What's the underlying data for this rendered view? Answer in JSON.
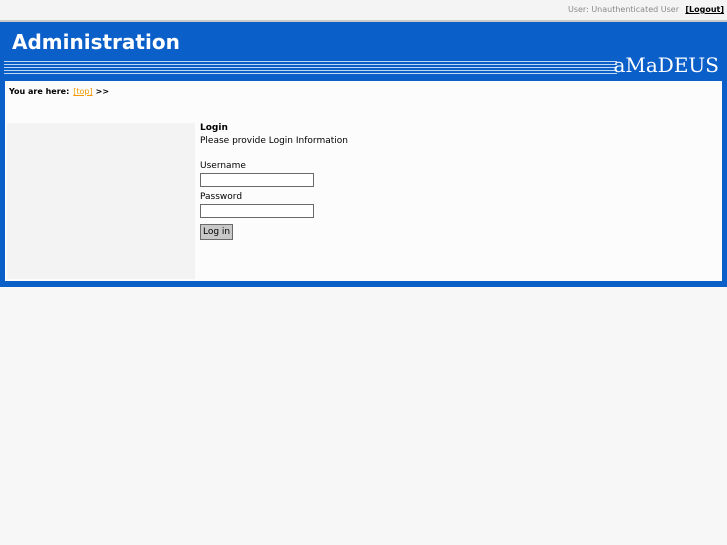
{
  "topbar": {
    "user_text": "User: Unauthenticated User",
    "logout_label": "[Logout]"
  },
  "header": {
    "title": "Administration",
    "logo_text": "aMaDEUS"
  },
  "breadcrumb": {
    "prefix": "You are here:",
    "top_link": "[top]",
    "separator": ">>"
  },
  "login": {
    "title": "Login",
    "hint": "Please provide Login Information",
    "username_label": "Username",
    "username_value": "",
    "password_label": "Password",
    "password_value": "",
    "submit_label": "Log in"
  },
  "colors": {
    "brand_blue": "#0a5fc9",
    "link_orange": "#f29a00"
  }
}
